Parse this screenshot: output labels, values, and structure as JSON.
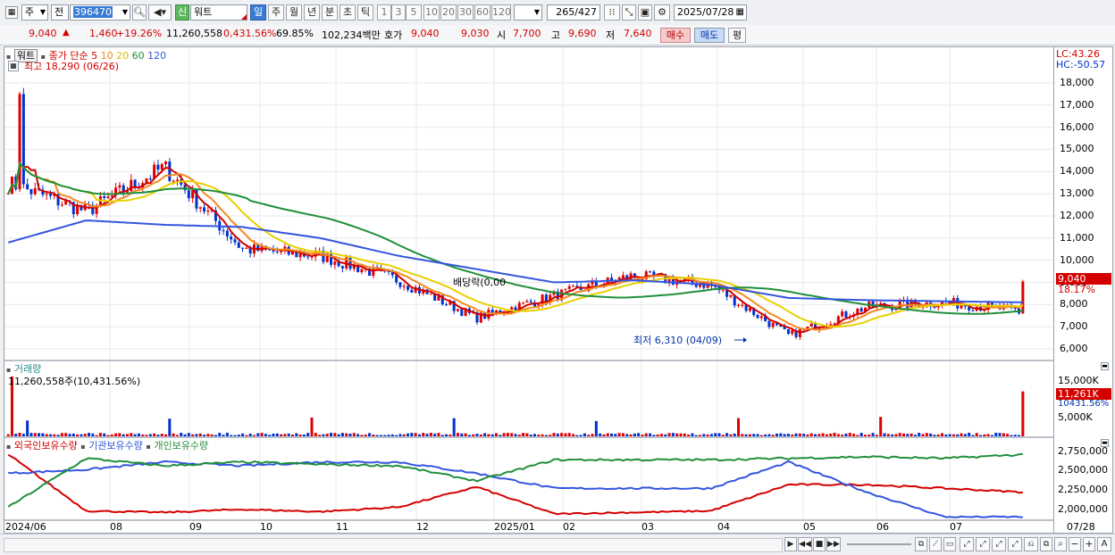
{
  "toolbar": {
    "period_type": "주",
    "prev_label": "전",
    "code": "396470",
    "badge": "신",
    "stock_name": "워트",
    "tabs": [
      "일",
      "주",
      "월",
      "년",
      "분",
      "초",
      "틱"
    ],
    "active_tab": "일",
    "intervals": [
      "1",
      "3",
      "5",
      "10",
      "20",
      "30",
      "60",
      "120"
    ],
    "count": "265",
    "total": "/427",
    "date": "2025/07/28"
  },
  "info": {
    "price": "9,040",
    "up_arrow": "▲",
    "change": "1,460",
    "change_pct": "+19.26%",
    "volume": "11,260,558",
    "vol_ratio": "0,431.56%",
    "rotation": "69.85%",
    "amount": "102,234백만",
    "bid_label": "호가",
    "ask_price": "9,040",
    "bid_price": "9,030",
    "open_label": "시",
    "open": "7,700",
    "high_label": "고",
    "high": "9,690",
    "low_label": "저",
    "low": "7,640",
    "buy_label": "매수",
    "sell_label": "매도",
    "eval_label": "평"
  },
  "main_chart": {
    "title": "워트",
    "legend_label": "종가 단순",
    "ma_periods": [
      "5",
      "10",
      "20",
      "60",
      "120"
    ],
    "ma_colors": [
      "#d40000",
      "#f58a1f",
      "#e8d000",
      "#1f8f3a",
      "#3355dd"
    ],
    "high_annotation": "최고 18,290 (06/26)",
    "low_annotation": "최저 6,310 (04/09)",
    "dividend_label": "배당락(0,00",
    "lc_label": "LC:43.26",
    "hc_label": "HC:-50.57",
    "price_tag": "9,040",
    "pct_tag": "18.17%",
    "y_ticks": [
      "18,000",
      "17,000",
      "16,000",
      "15,000",
      "14,000",
      "13,000",
      "12,000",
      "11,000",
      "10,000",
      "9,000",
      "8,000",
      "7,000",
      "6,000"
    ]
  },
  "volume_panel": {
    "title": "거래량",
    "value_label": "11,260,558주(10,431.56%)",
    "y_ticks": [
      "15,000K",
      "10,000K",
      "5,000K"
    ],
    "tag": "11,261K",
    "tag2": "10431.56%"
  },
  "holding_panel": {
    "titles": [
      "외국인보유수량",
      "기관보유수량",
      "개인보유수량"
    ],
    "title_colors": [
      "#d40000",
      "#3355dd",
      "#1f8f3a"
    ],
    "y_ticks": [
      "2,750,000",
      "2,500,000",
      "2,250,000",
      "2,000,000"
    ]
  },
  "x_axis": {
    "labels": [
      "2024/06",
      "08",
      "09",
      "10",
      "11",
      "12",
      "2025/01",
      "02",
      "03",
      "04",
      "05",
      "06",
      "07"
    ],
    "end_label": "07/28"
  },
  "chart_data": [
    {
      "type": "line",
      "title": "워트",
      "y_unit": "KRW",
      "ylim": [
        5600,
        18800
      ],
      "x": [
        "2024/06",
        "07",
        "08",
        "09",
        "10",
        "11",
        "12",
        "2025/01",
        "02",
        "03",
        "04",
        "05",
        "06",
        "07"
      ],
      "series": [
        {
          "name": "5",
          "values": [
            13500,
            12200,
            14200,
            10500,
            10200,
            9100,
            7400,
            8400,
            9300,
            8900,
            6600,
            7900,
            8100,
            7700
          ]
        },
        {
          "name": "120",
          "values": [
            10800,
            11800,
            11600,
            11500,
            11000,
            10200,
            9600,
            9000,
            9100,
            8900,
            8300,
            8200,
            8150,
            8100
          ]
        }
      ],
      "annotations": [
        {
          "text": "최고 18,290 (06/26)",
          "value": 18290
        },
        {
          "text": "최저 6,310 (04/09)",
          "value": 6310
        }
      ]
    },
    {
      "type": "bar",
      "title": "거래량",
      "unit": "K",
      "ylim": [
        0,
        17000
      ],
      "last_value": 11261
    },
    {
      "type": "line",
      "title": "보유수량",
      "ylim": [
        1900000,
        2850000
      ],
      "x": [
        "2024/06",
        "08",
        "09",
        "10",
        "11",
        "12",
        "2025/01",
        "02",
        "03",
        "04",
        "05",
        "06",
        "07",
        "07/28"
      ],
      "series": [
        {
          "name": "외국인보유수량",
          "values": [
            2750000,
            2000000,
            1980000,
            2020000,
            1990000,
            2050000,
            2320000,
            1960000,
            1980000,
            2000000,
            2350000,
            2350000,
            2300000,
            2250000
          ]
        },
        {
          "name": "기관보유수량",
          "values": [
            2500000,
            2550000,
            2650000,
            2600000,
            2650000,
            2650000,
            2500000,
            2300000,
            2300000,
            2300000,
            2650000,
            2250000,
            1920000,
            1920000
          ]
        },
        {
          "name": "개인보유수량",
          "values": [
            2050000,
            2700000,
            2600000,
            2650000,
            2620000,
            2600000,
            2400000,
            2680000,
            2680000,
            2680000,
            2700000,
            2720000,
            2700000,
            2750000
          ]
        }
      ]
    }
  ]
}
